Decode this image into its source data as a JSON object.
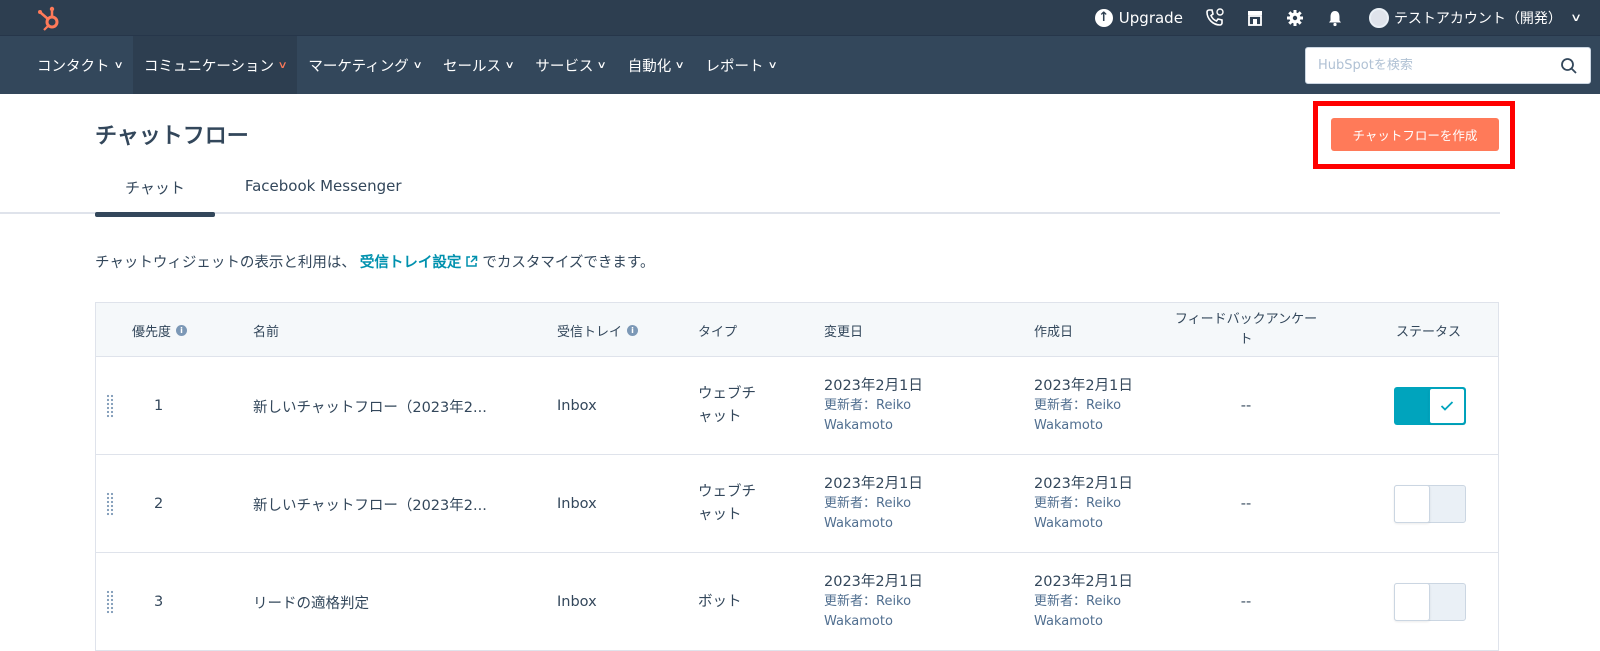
{
  "topbar": {
    "upgrade_label": "Upgrade",
    "account_name": "テストアカウント（開発）"
  },
  "nav": {
    "items": [
      {
        "label": "コンタクト"
      },
      {
        "label": "コミュニケーション"
      },
      {
        "label": "マーケティング"
      },
      {
        "label": "セールス"
      },
      {
        "label": "サービス"
      },
      {
        "label": "自動化"
      },
      {
        "label": "レポート"
      }
    ],
    "active_index": 1,
    "search_placeholder": "HubSpotを検索"
  },
  "page": {
    "title": "チャットフロー",
    "create_button": "チャットフローを作成",
    "tabs": [
      {
        "label": "チャット"
      },
      {
        "label": "Facebook Messenger"
      }
    ],
    "info_prefix": "チャットウィジェットの表示と利用は、",
    "info_link": "受信トレイ設定",
    "info_suffix": "でカスタマイズできます。"
  },
  "table": {
    "headers": {
      "priority": "優先度",
      "name": "名前",
      "inbox": "受信トレイ",
      "type": "タイプ",
      "modified": "変更日",
      "created": "作成日",
      "feedback_line1": "フィードバックアンケー",
      "feedback_line2": "ト",
      "status": "ステータス"
    },
    "rows": [
      {
        "priority": "1",
        "name": "新しいチャットフロー（2023年2...",
        "inbox": "Inbox",
        "type_line1": "ウェブチ",
        "type_line2": "ャット",
        "modified_date": "2023年2月1日",
        "modified_by_line1": "更新者：Reiko",
        "modified_by_line2": "Wakamoto",
        "created_date": "2023年2月1日",
        "created_by_line1": "更新者：Reiko",
        "created_by_line2": "Wakamoto",
        "feedback": "--",
        "status_on": true
      },
      {
        "priority": "2",
        "name": "新しいチャットフロー（2023年2...",
        "inbox": "Inbox",
        "type_line1": "ウェブチ",
        "type_line2": "ャット",
        "modified_date": "2023年2月1日",
        "modified_by_line1": "更新者：Reiko",
        "modified_by_line2": "Wakamoto",
        "created_date": "2023年2月1日",
        "created_by_line1": "更新者：Reiko",
        "created_by_line2": "Wakamoto",
        "feedback": "--",
        "status_on": false
      },
      {
        "priority": "3",
        "name": "リードの適格判定",
        "inbox": "Inbox",
        "type_line1": "ボット",
        "type_line2": "",
        "modified_date": "2023年2月1日",
        "modified_by_line1": "更新者：Reiko",
        "modified_by_line2": "Wakamoto",
        "created_date": "2023年2月1日",
        "created_by_line1": "更新者：Reiko",
        "created_by_line2": "Wakamoto",
        "feedback": "--",
        "status_on": false
      }
    ]
  },
  "colors": {
    "accent": "#ff7a59",
    "toggle_on": "#00a4bd",
    "link": "#0091ae",
    "highlight_box": "#ff0000"
  }
}
